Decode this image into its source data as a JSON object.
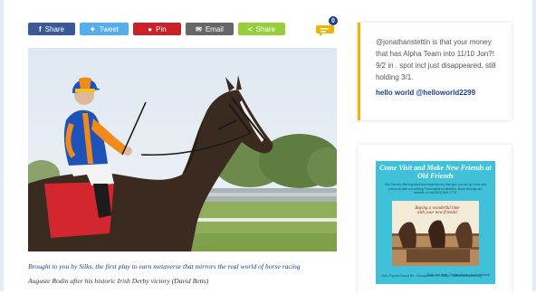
{
  "share": {
    "facebook_label": "Share",
    "twitter_label": "Tweet",
    "pinterest_label": "Pin",
    "email_label": "Email",
    "share_label": "Share"
  },
  "comments": {
    "count": "0"
  },
  "photo": {
    "caption_promo": "Brought to you by Silks, the first play to earn metaverse that mirrors the real world of horse racing",
    "caption": "Auguste Rodin after his historic Irish Derby victory (David Betts)"
  },
  "tweet": {
    "text": "@jonathanstettin is that your money that has Alpha Team into 11/10 Jon?! 9/2 in . spot incl just disappeared, still holding 3/1.",
    "handle": "hello world @helloworld2299"
  },
  "ad": {
    "headline": "Come Visit and Make New Friends at Old Friends",
    "body": "Old Friends offers guided tour experiences that give you an up close and personal with our retiring Thoroughbred athletes. Book through our website or call (502) 863-1775.",
    "tagline": "Buying a wonderful time with your new friends!",
    "footer_left": "1841 Paynes Depot Rd · Georgetown, KY 40324 · oldfriendsequine.org",
    "footer_right": "Tours run daily · Reservations recommended"
  },
  "colors": {
    "facebook": "#3b5998",
    "twitter": "#55acee",
    "pinterest": "#cb2027",
    "email": "#666666",
    "share": "#95d03a",
    "accent": "#f2b400",
    "link": "#1f3a93",
    "ad_bg": "#3fc2d9"
  }
}
